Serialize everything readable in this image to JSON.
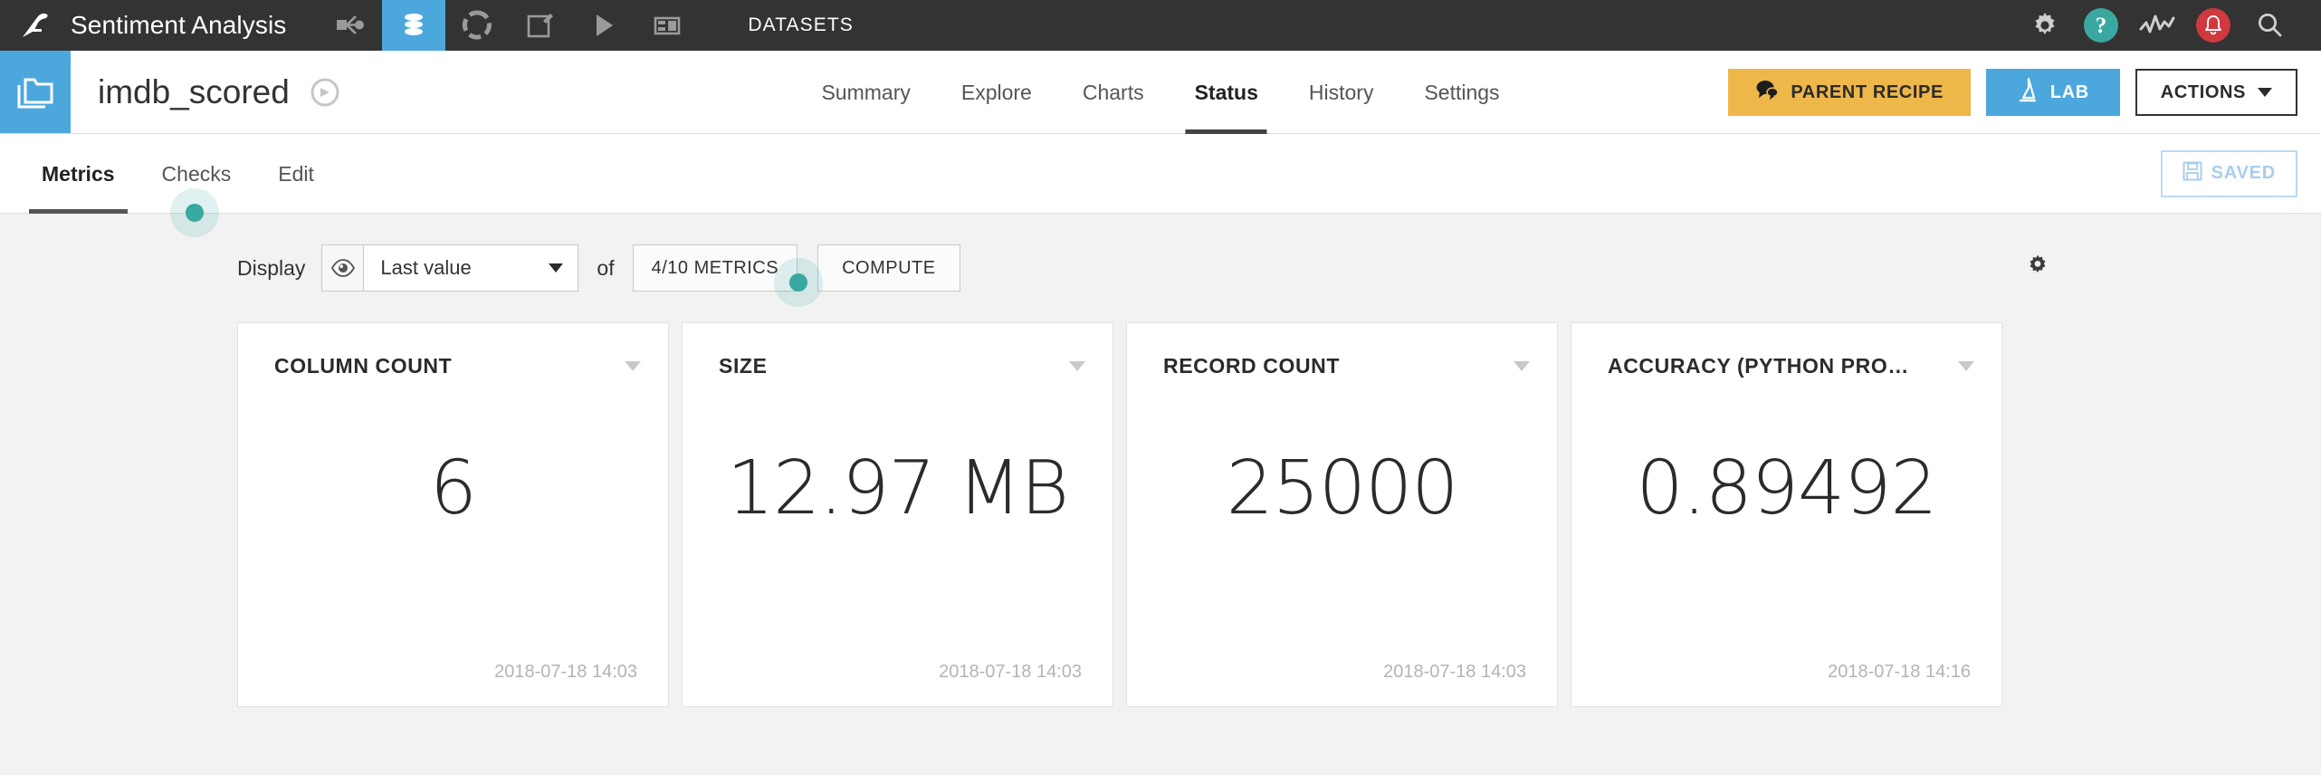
{
  "topbar": {
    "logo_icon": "dataiku-bird-logo-icon",
    "project_name": "Sentiment Analysis",
    "nav_icons": [
      {
        "name": "flow-icon",
        "label": "Flow",
        "active": false
      },
      {
        "name": "datasets-icon",
        "label": "Datasets",
        "active": true
      },
      {
        "name": "recipes-icon",
        "label": "Recipes",
        "active": false
      },
      {
        "name": "notebooks-icon",
        "label": "Notebooks",
        "active": false
      },
      {
        "name": "jobs-icon",
        "label": "Jobs",
        "active": false
      },
      {
        "name": "dashboards-icon",
        "label": "Dashboards",
        "active": false
      }
    ],
    "section_label": "DATASETS",
    "right_icons": [
      {
        "name": "gear-icon",
        "label": "Administration"
      },
      {
        "name": "help-icon",
        "label": "Help",
        "glyph": "?",
        "color": "#3aa8a0"
      },
      {
        "name": "monitoring-icon",
        "label": "Monitoring"
      },
      {
        "name": "notifications-icon",
        "label": "Notifications",
        "color": "#d0393e"
      },
      {
        "name": "search-icon",
        "label": "Search"
      }
    ]
  },
  "header": {
    "folder_icon": "dataset-folder-icon",
    "dataset_name": "imdb_scored",
    "compass_icon": "compass-icon",
    "tabs": [
      {
        "label": "Summary",
        "active": false
      },
      {
        "label": "Explore",
        "active": false
      },
      {
        "label": "Charts",
        "active": false
      },
      {
        "label": "Status",
        "active": true
      },
      {
        "label": "History",
        "active": false
      },
      {
        "label": "Settings",
        "active": false
      }
    ],
    "parent_recipe_label": "PARENT RECIPE",
    "parent_recipe_icon": "speech-bubble-icon",
    "parent_recipe_color": "#eeb74a",
    "lab_label": "LAB",
    "lab_icon": "microscope-icon",
    "lab_color": "#4ca7dd",
    "actions_label": "ACTIONS",
    "actions_caret_icon": "chevron-down-icon"
  },
  "subtabs": {
    "tabs": [
      {
        "label": "Metrics",
        "active": true
      },
      {
        "label": "Checks",
        "active": false
      },
      {
        "label": "Edit",
        "active": false
      }
    ],
    "saved_label": "SAVED",
    "saved_icon": "floppy-disk-icon",
    "saved_color": "#a9cdec"
  },
  "toolbar": {
    "display_label": "Display",
    "eye_icon": "eye-icon",
    "display_value": "Last value",
    "display_caret_icon": "chevron-down-icon",
    "of_label": "of",
    "metrics_selector_label": "4/10 METRICS",
    "compute_label": "COMPUTE",
    "settings_gear_icon": "gear-icon"
  },
  "accent_colors": {
    "blue": "#4ca7dd",
    "teal": "#3aa8a0",
    "amber": "#eeb74a",
    "red": "#d0393e",
    "dark": "#333333"
  },
  "cards": [
    {
      "title": "COLUMN COUNT",
      "value": "6",
      "timestamp": "2018-07-18 14:03"
    },
    {
      "title": "SIZE",
      "value": "12.97 MB",
      "timestamp": "2018-07-18 14:03"
    },
    {
      "title": "RECORD COUNT",
      "value": "25000",
      "timestamp": "2018-07-18 14:03"
    },
    {
      "title": "ACCURACY (PYTHON PRO…",
      "value": "0.89492",
      "timestamp": "2018-07-18 14:16"
    }
  ]
}
